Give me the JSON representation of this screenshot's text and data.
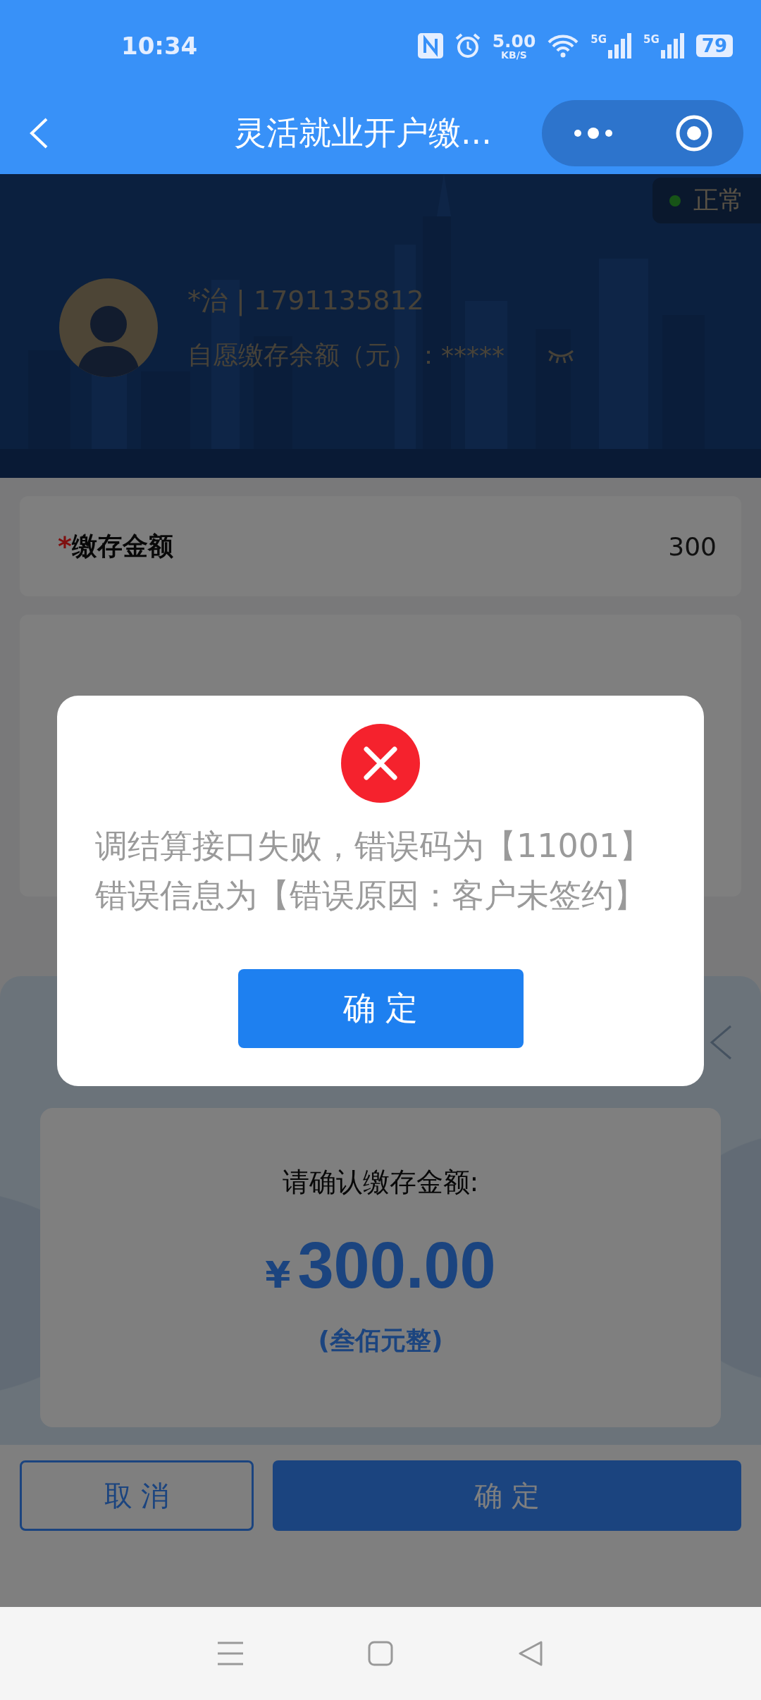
{
  "status_bar": {
    "time": "10:34",
    "net_speed": "5.00",
    "net_speed_unit": "KB/S",
    "signal_labels": [
      "5G",
      "5G"
    ],
    "battery": "79"
  },
  "nav": {
    "title": "灵活就业开户缴..."
  },
  "profile": {
    "status": "正常",
    "name": "*治 | 1791135812",
    "balance_label": "自愿缴存余额（元）：",
    "balance_value": "*****"
  },
  "amount_field": {
    "required_mark": "*",
    "label": "缴存金额",
    "value": "300"
  },
  "sheet": {
    "prompt": "请确认缴存金额:",
    "currency": "¥",
    "amount": "300.00",
    "amount_words": "(叁佰元整)",
    "buttons": [
      {
        "label": "取 消",
        "kind": "secondary"
      },
      {
        "label": "确 定",
        "kind": "primary"
      }
    ]
  },
  "dialog": {
    "kind": "error",
    "message": "调结算接口失败，错误码为【11001】错误信息为【错误原因：客户未签约】",
    "button": "确 定"
  }
}
